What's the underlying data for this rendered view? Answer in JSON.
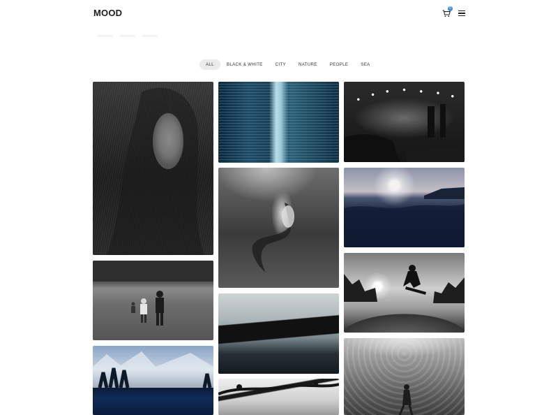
{
  "header": {
    "logo": "MOOD",
    "cart_count": "0",
    "cart_icon": "cart-icon",
    "menu_icon": "hamburger-menu-icon"
  },
  "filters": [
    {
      "label": "ALL",
      "active": true
    },
    {
      "label": "BLACK & WHITE",
      "active": false
    },
    {
      "label": "CITY",
      "active": false
    },
    {
      "label": "NATURE",
      "active": false
    },
    {
      "label": "PEOPLE",
      "active": false
    },
    {
      "label": "SEA",
      "active": false
    }
  ],
  "colors": {
    "badge": "#3d8bd8",
    "active_filter_bg": "#ebebeb"
  }
}
